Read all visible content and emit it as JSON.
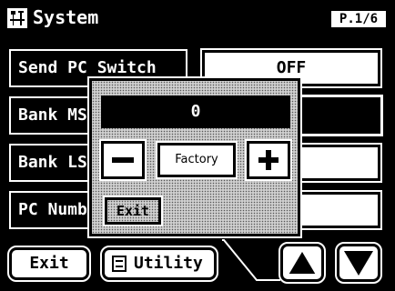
{
  "title_bar": {
    "title": "System",
    "page_indicator": "P.1/6",
    "icon": "tools-icon"
  },
  "params": [
    {
      "label": "Send PC Switch",
      "value": "OFF"
    },
    {
      "label": "Bank MSB",
      "value": ""
    },
    {
      "label": "Bank LSB",
      "value": ""
    },
    {
      "label": "PC Number",
      "value": ""
    }
  ],
  "popup": {
    "value": "0",
    "minus_icon": "minus-icon",
    "factory_label": "Factory",
    "plus_icon": "plus-icon",
    "exit_label": "Exit"
  },
  "bottom_bar": {
    "exit_label": "Exit",
    "utility_label": "Utility",
    "utility_icon": "list-icon",
    "page_up_icon": "triangle-up-icon",
    "page_down_icon": "triangle-down-icon"
  }
}
